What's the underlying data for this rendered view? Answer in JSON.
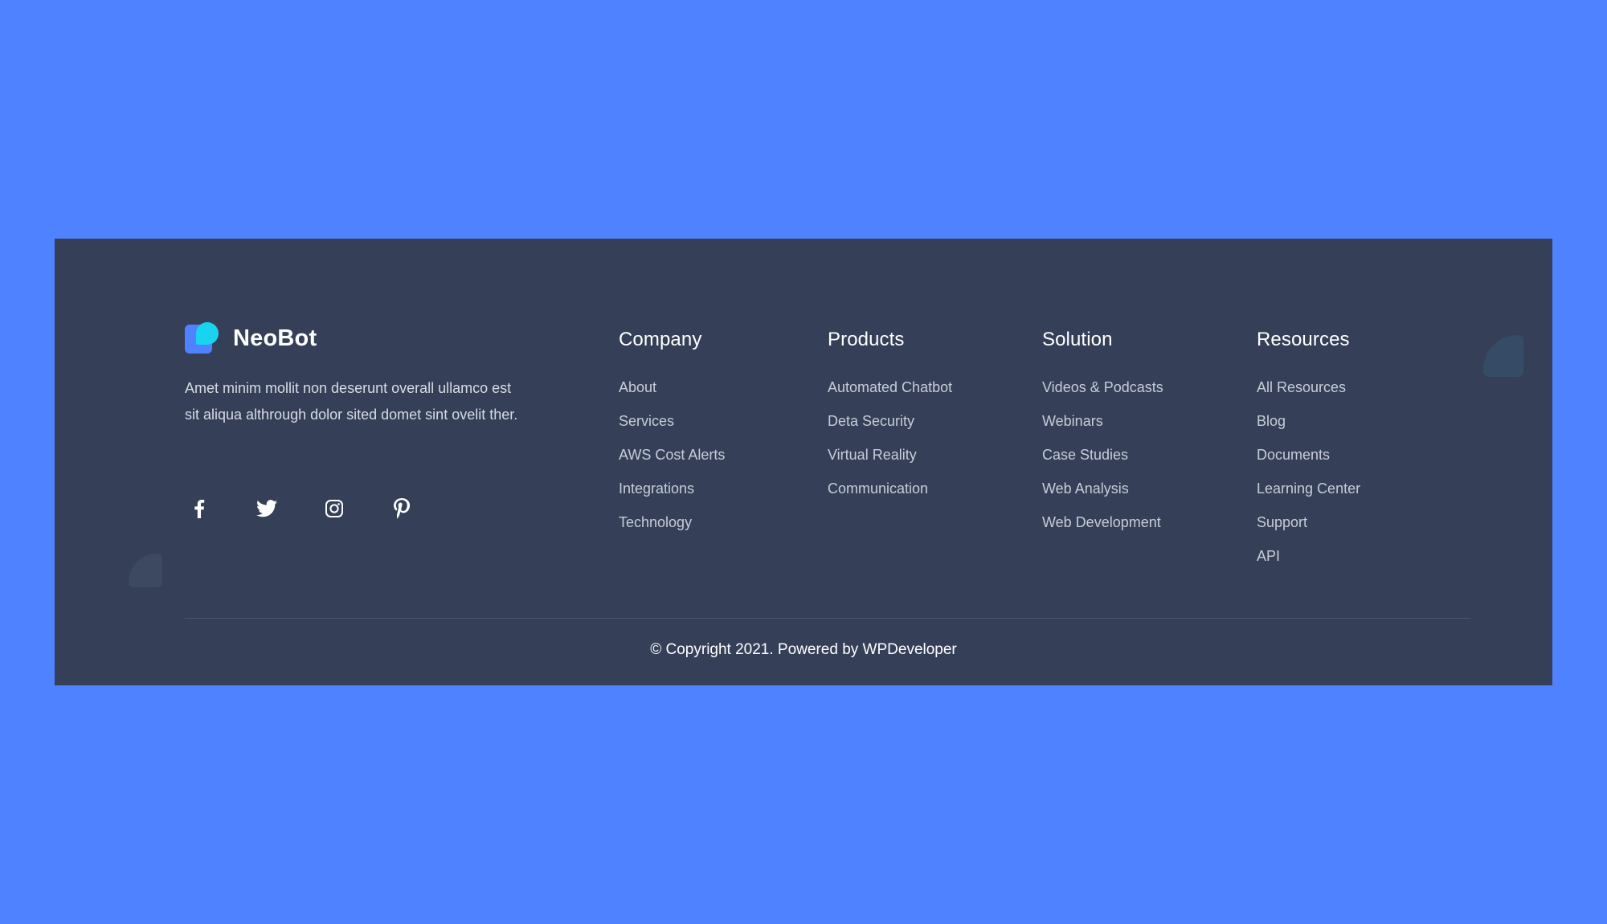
{
  "brand": {
    "name": "NeoBot",
    "description": "Amet minim mollit non deserunt overall ullamco est sit aliqua althrough dolor sited domet sint ovelit ther."
  },
  "social": [
    {
      "icon": "facebook-icon"
    },
    {
      "icon": "twitter-icon"
    },
    {
      "icon": "instagram-icon"
    },
    {
      "icon": "pinterest-icon"
    }
  ],
  "columns": {
    "company": {
      "title": "Company",
      "links": [
        "About",
        "Services",
        "AWS Cost Alerts",
        "Integrations",
        "Technology"
      ]
    },
    "products": {
      "title": "Products",
      "links": [
        "Automated Chatbot",
        "Deta Security",
        "Virtual Reality",
        "Communication"
      ]
    },
    "solution": {
      "title": "Solution",
      "links": [
        "Videos & Podcasts",
        "Webinars",
        "Case Studies",
        "Web Analysis",
        "Web Development"
      ]
    },
    "resources": {
      "title": "Resources",
      "links": [
        "All Resources",
        "Blog",
        "Documents",
        "Learning Center",
        "Support",
        "API"
      ]
    }
  },
  "copyright": "© Copyright 2021. Powered by WPDeveloper",
  "colors": {
    "page_background": "#4f82ff",
    "footer_background": "#354058",
    "logo_blue": "#4f82ff",
    "logo_cyan": "#18d4f1",
    "link_text": "#c7ccd7",
    "heading_text": "#ffffff"
  }
}
